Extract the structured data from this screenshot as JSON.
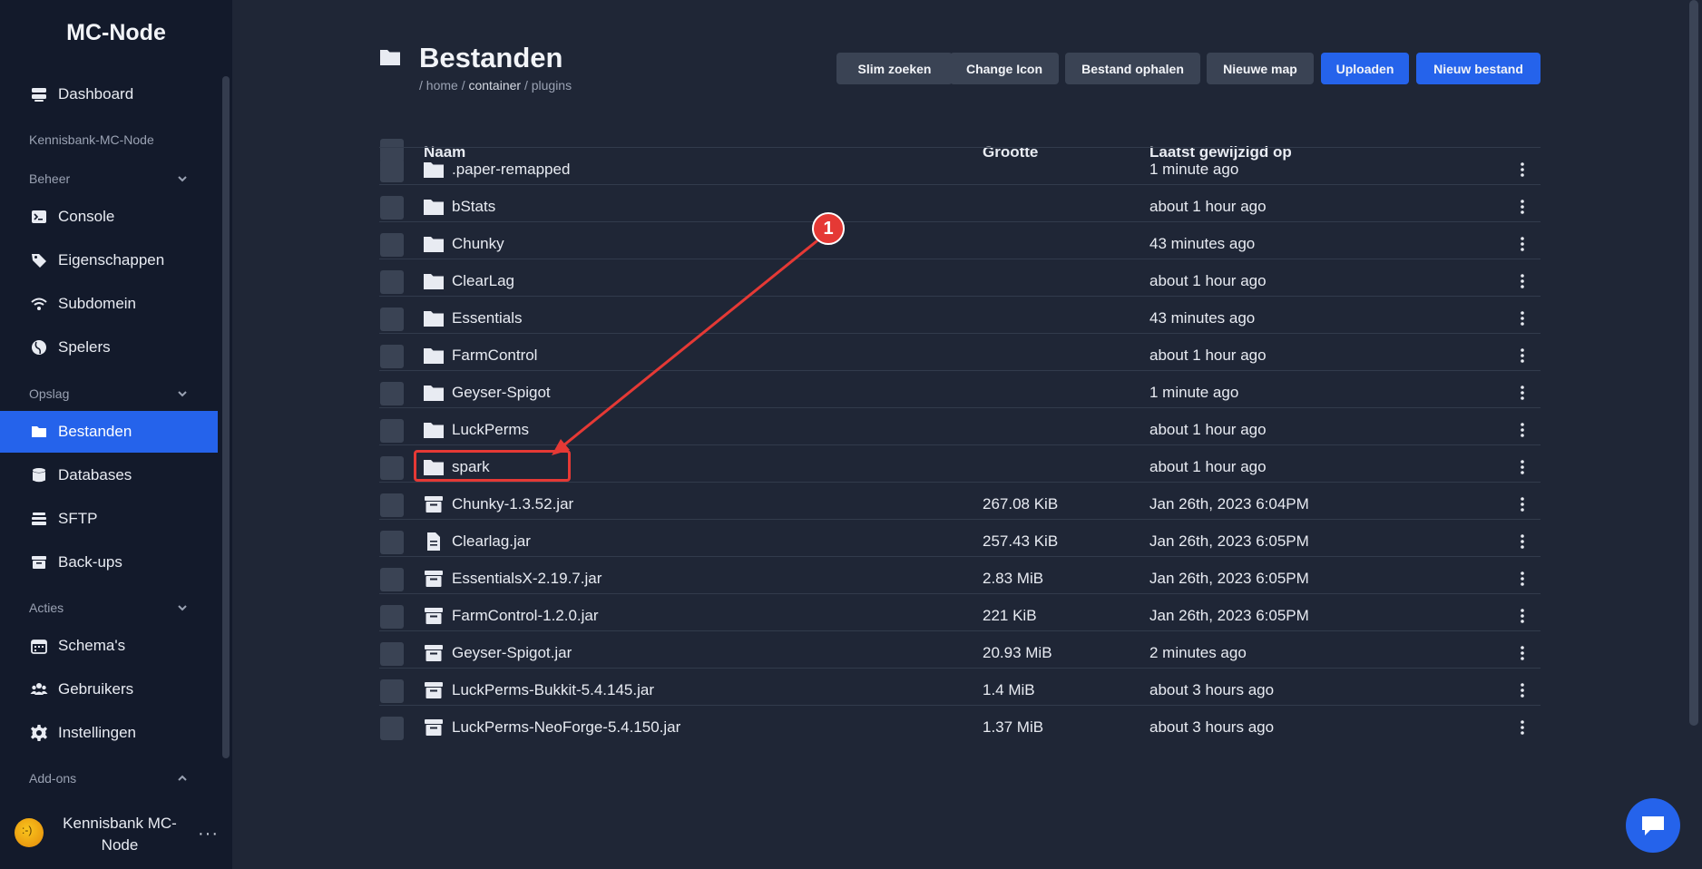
{
  "brand": "MC-Node",
  "sidebar": {
    "items": [
      {
        "label": "Dashboard",
        "icon": "server-icon"
      },
      {
        "label": "Console",
        "icon": "terminal-icon"
      },
      {
        "label": "Eigenschappen",
        "icon": "tag-icon"
      },
      {
        "label": "Subdomein",
        "icon": "wifi-icon"
      },
      {
        "label": "Spelers",
        "icon": "globe-icon"
      },
      {
        "label": "Bestanden",
        "icon": "folder-icon",
        "active": true
      },
      {
        "label": "Databases",
        "icon": "database-icon"
      },
      {
        "label": "SFTP",
        "icon": "stack-icon"
      },
      {
        "label": "Back-ups",
        "icon": "archive-icon"
      },
      {
        "label": "Schema's",
        "icon": "calendar-icon"
      },
      {
        "label": "Gebruikers",
        "icon": "users-icon"
      },
      {
        "label": "Instellingen",
        "icon": "gear-icon"
      }
    ],
    "sections": {
      "server_name": "Kennisbank-MC-Node",
      "beheer": "Beheer",
      "opslag": "Opslag",
      "acties": "Acties",
      "addons": "Add-ons"
    },
    "user": {
      "name": "Kennisbank MC-Node",
      "menu": "···"
    }
  },
  "header": {
    "title": "Bestanden",
    "breadcrumb": {
      "sep1": "/ home / ",
      "container": "container",
      "sep2": " / plugins"
    }
  },
  "toolbar": {
    "smart_search": "Slim zoeken",
    "change_icon": "Change Icon",
    "fetch_file": "Bestand ophalen",
    "new_folder": "Nieuwe map",
    "upload": "Uploaden",
    "new_file": "Nieuw bestand"
  },
  "table": {
    "headers": {
      "name": "Naam",
      "size": "Grootte",
      "modified": "Laatst gewijzigd op"
    },
    "rows": [
      {
        "name": ".paper-remapped",
        "size": "",
        "modified": "1 minute ago",
        "type": "folder"
      },
      {
        "name": "bStats",
        "size": "",
        "modified": "about 1 hour ago",
        "type": "folder"
      },
      {
        "name": "Chunky",
        "size": "",
        "modified": "43 minutes ago",
        "type": "folder"
      },
      {
        "name": "ClearLag",
        "size": "",
        "modified": "about 1 hour ago",
        "type": "folder"
      },
      {
        "name": "Essentials",
        "size": "",
        "modified": "43 minutes ago",
        "type": "folder"
      },
      {
        "name": "FarmControl",
        "size": "",
        "modified": "about 1 hour ago",
        "type": "folder"
      },
      {
        "name": "Geyser-Spigot",
        "size": "",
        "modified": "1 minute ago",
        "type": "folder"
      },
      {
        "name": "LuckPerms",
        "size": "",
        "modified": "about 1 hour ago",
        "type": "folder"
      },
      {
        "name": "spark",
        "size": "",
        "modified": "about 1 hour ago",
        "type": "folder"
      },
      {
        "name": "Chunky-1.3.52.jar",
        "size": "267.08 KiB",
        "modified": "Jan 26th, 2023 6:04PM",
        "type": "archive"
      },
      {
        "name": "Clearlag.jar",
        "size": "257.43 KiB",
        "modified": "Jan 26th, 2023 6:05PM",
        "type": "file"
      },
      {
        "name": "EssentialsX-2.19.7.jar",
        "size": "2.83 MiB",
        "modified": "Jan 26th, 2023 6:05PM",
        "type": "archive"
      },
      {
        "name": "FarmControl-1.2.0.jar",
        "size": "221 KiB",
        "modified": "Jan 26th, 2023 6:05PM",
        "type": "archive"
      },
      {
        "name": "Geyser-Spigot.jar",
        "size": "20.93 MiB",
        "modified": "2 minutes ago",
        "type": "archive"
      },
      {
        "name": "LuckPerms-Bukkit-5.4.145.jar",
        "size": "1.4 MiB",
        "modified": "about 3 hours ago",
        "type": "archive"
      },
      {
        "name": "LuckPerms-NeoForge-5.4.150.jar",
        "size": "1.37 MiB",
        "modified": "about 3 hours ago",
        "type": "archive"
      }
    ]
  },
  "annotation": {
    "badge": "1",
    "color": "#e53935"
  },
  "colors": {
    "accent": "#2563eb",
    "sidebar_bg": "#131a2b",
    "main_bg": "#1f2636"
  }
}
